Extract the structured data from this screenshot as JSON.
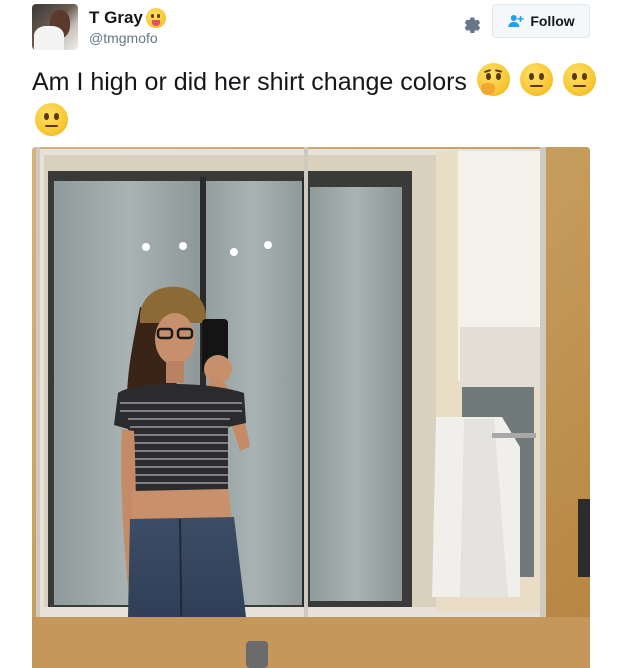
{
  "tweet": {
    "display_name": "T Gray",
    "handle": "@tmgmofo",
    "name_emoji": "face-with-tongue-emoji",
    "follow_label": "Follow",
    "text": "Am I high or did her shirt change colors",
    "text_emojis": [
      "thinking-face-emoji",
      "neutral-face-emoji",
      "neutral-face-emoji",
      "neutral-face-emoji"
    ],
    "photo_description": "mirror-selfie-photo"
  },
  "colors": {
    "name_text": "#14171a",
    "handle_text": "#657786",
    "follow_icon": "#1da1f2",
    "button_border": "#e1e8ed",
    "button_bg": "#f5f8fa"
  }
}
